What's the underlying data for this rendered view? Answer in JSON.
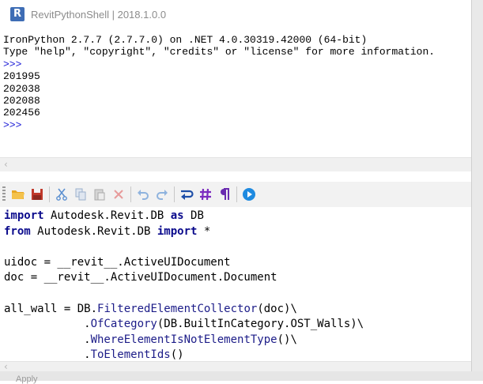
{
  "window": {
    "title": "RevitPythonShell | 2018.1.0.0",
    "logo_letter": "R"
  },
  "console": {
    "lines": [
      {
        "text": "IronPython 2.7.7 (2.7.7.0) on .NET 4.0.30319.42000 (64-bit)",
        "type": "output"
      },
      {
        "text": "Type \"help\", \"copyright\", \"credits\" or \"license\" for more information.",
        "type": "output"
      },
      {
        "text": ">>>",
        "type": "prompt"
      },
      {
        "text": "201995",
        "type": "output"
      },
      {
        "text": "202038",
        "type": "output"
      },
      {
        "text": "202088",
        "type": "output"
      },
      {
        "text": "202456",
        "type": "output"
      },
      {
        "text": ">>>",
        "type": "prompt"
      }
    ]
  },
  "toolbar": {
    "open_tip": "open-folder-icon",
    "items": [
      "open-folder-icon",
      "save-icon",
      "cut-icon",
      "copy-icon",
      "paste-icon",
      "delete-icon",
      "undo-icon",
      "redo-icon",
      "word-wrap-icon",
      "hash-icon",
      "pilcrow-icon",
      "run-icon"
    ]
  },
  "editor": {
    "lines": [
      [
        {
          "t": "import",
          "c": "kw"
        },
        {
          "t": " Autodesk.Revit.DB "
        },
        {
          "t": "as",
          "c": "kw"
        },
        {
          "t": " DB"
        }
      ],
      [
        {
          "t": "from",
          "c": "kw"
        },
        {
          "t": " Autodesk.Revit.DB "
        },
        {
          "t": "import",
          "c": "kw"
        },
        {
          "t": " *"
        }
      ],
      [],
      [
        {
          "t": "uidoc = __revit__.ActiveUIDocument"
        }
      ],
      [
        {
          "t": "doc = __revit__.ActiveUIDocument.Document"
        }
      ],
      [],
      [
        {
          "t": "all_wall = DB."
        },
        {
          "t": "FilteredElementCollector",
          "c": "fn"
        },
        {
          "t": "(doc)\\"
        }
      ],
      [
        {
          "t": "            ."
        },
        {
          "t": "OfCategory",
          "c": "fn"
        },
        {
          "t": "(DB.BuiltInCategory.OST_Walls)\\"
        }
      ],
      [
        {
          "t": "            ."
        },
        {
          "t": "WhereElementIsNotElementType",
          "c": "fn"
        },
        {
          "t": "()\\"
        }
      ],
      [
        {
          "t": "            ."
        },
        {
          "t": "ToElementIds",
          "c": "fn"
        },
        {
          "t": "()"
        }
      ]
    ]
  },
  "background": {
    "apply_label": "Apply"
  },
  "colors": {
    "prompt": "#1a1ad6",
    "keyword": "#0a0a8c",
    "accent": "#3e6db5"
  }
}
